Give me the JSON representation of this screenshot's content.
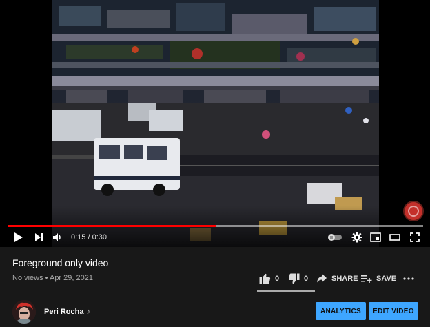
{
  "player": {
    "time_display": "0:15 / 0:30",
    "progress": 0.5,
    "buffered": 1.0
  },
  "video": {
    "title": "Foreground only video",
    "meta": "No views • Apr 29, 2021"
  },
  "actions": {
    "like_count": "0",
    "dislike_count": "0",
    "share_label": "SHARE",
    "save_label": "SAVE"
  },
  "channel": {
    "name": "Peri Rocha",
    "badge": "♪"
  },
  "buttons": {
    "analytics_label": "ANALYTICS",
    "edit_label": "EDIT VIDEO"
  },
  "colors": {
    "accent_blue": "#3ea6ff",
    "progress_red": "#ff0000",
    "background": "#181818"
  }
}
